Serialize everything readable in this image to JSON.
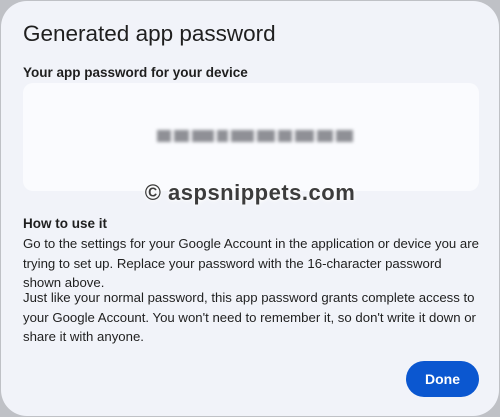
{
  "dialog": {
    "title": "Generated app password",
    "password_label": "Your app password for your device",
    "password_value_obscured": true,
    "watermark": "© aspsnippets.com",
    "how_to_heading": "How to use it",
    "instructions_1": "Go to the settings for your Google Account in the application or device you are trying to set up. Replace your password with the 16-character password shown above.",
    "instructions_2": "Just like your normal password, this app password grants complete access to your Google Account. You won't need to remember it, so don't write it down or share it with anyone.",
    "done_label": "Done"
  },
  "colors": {
    "dialog_background": "#f1f3f9",
    "password_box_background": "#fafbfe",
    "primary_button": "#0b57d0"
  }
}
